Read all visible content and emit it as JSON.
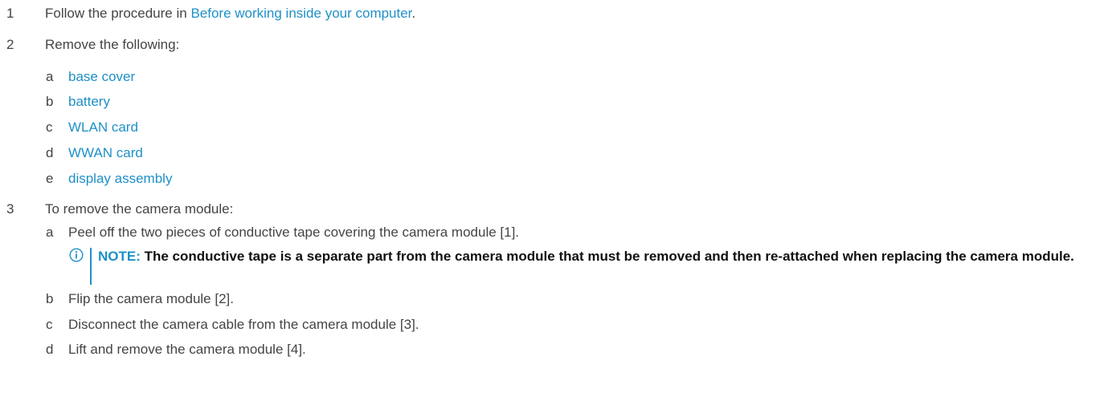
{
  "steps": [
    {
      "num": "1",
      "prefix": "Follow the procedure in ",
      "link": "Before working inside your computer",
      "suffix": "."
    },
    {
      "num": "2",
      "text": "Remove the following:",
      "substeps": [
        {
          "letter": "a",
          "link": "base cover"
        },
        {
          "letter": "b",
          "link": "battery"
        },
        {
          "letter": "c",
          "link": "WLAN card"
        },
        {
          "letter": "d",
          "link": "WWAN card"
        },
        {
          "letter": "e",
          "link": "display assembly"
        }
      ]
    },
    {
      "num": "3",
      "text": "To remove the camera module:",
      "substeps": [
        {
          "letter": "a",
          "text": "Peel off the two pieces of conductive tape covering the camera module [1]."
        },
        {
          "letter": "b",
          "text": "Flip the camera module [2]."
        },
        {
          "letter": "c",
          "text": "Disconnect the camera cable from the camera module [3]."
        },
        {
          "letter": "d",
          "text": "Lift and remove the camera module [4]."
        }
      ]
    }
  ],
  "note": {
    "label": "NOTE:",
    "text": " The conductive tape is a separate part from the camera module that must be removed and then re-attached when replacing the camera module.",
    "icon": "info-icon",
    "accent_color": "#1e90c8"
  },
  "colors": {
    "text": "#444444",
    "link": "#1e90c8",
    "note_text": "#111111"
  }
}
